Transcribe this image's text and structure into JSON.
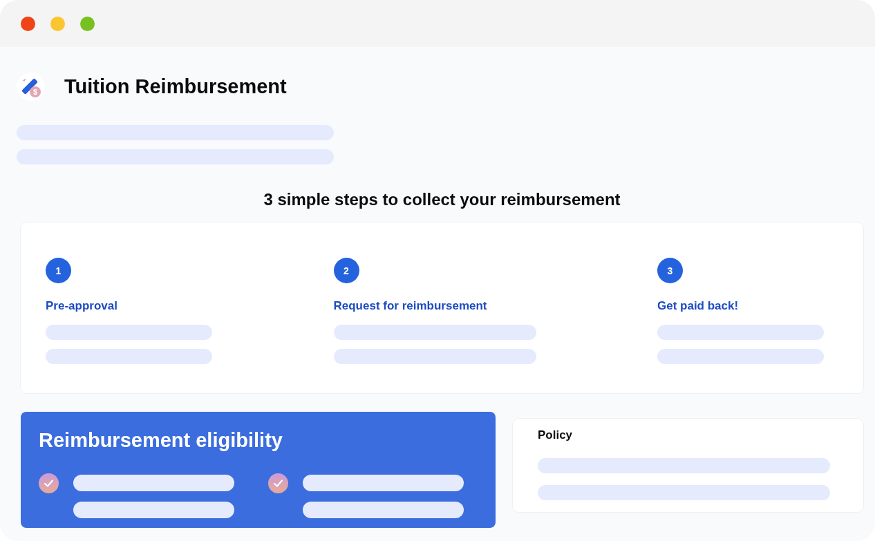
{
  "window": {
    "controls": [
      {
        "color": "#ee4418"
      },
      {
        "color": "#fbc52f"
      },
      {
        "color": "#76c11f"
      }
    ]
  },
  "header": {
    "logo_mark": "$",
    "title": "Tuition Reimbursement"
  },
  "steps_section": {
    "heading": "3 simple steps to collect your reimbursement",
    "steps": [
      {
        "number": "1",
        "label": "Pre-approval"
      },
      {
        "number": "2",
        "label": "Request for reimbursement"
      },
      {
        "number": "3",
        "label": "Get paid back!"
      }
    ]
  },
  "eligibility": {
    "title": "Reimbursement eligibility",
    "criteria": [
      {
        "checked": true
      },
      {
        "checked": true
      }
    ]
  },
  "policy": {
    "title": "Policy"
  }
}
